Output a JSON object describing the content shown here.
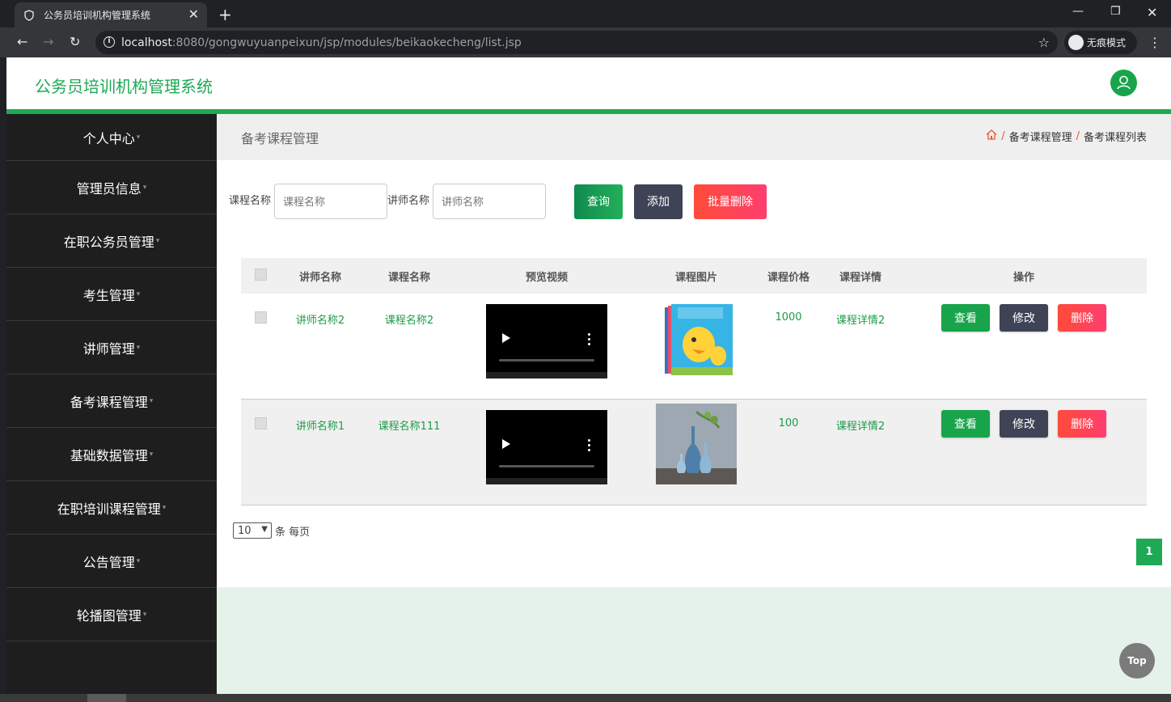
{
  "browser": {
    "tab_title": "公务员培训机构管理系统",
    "url_host": "localhost",
    "url_path": ":8080/gongwuyuanpeixun/jsp/modules/beikaokecheng/list.jsp",
    "incognito_label": "无痕模式"
  },
  "app": {
    "title": "公务员培训机构管理系统",
    "accent_color": "#1eaa54"
  },
  "sidebar": {
    "items": [
      {
        "label": "个人中心"
      },
      {
        "label": "管理员信息"
      },
      {
        "label": "在职公务员管理"
      },
      {
        "label": "考生管理"
      },
      {
        "label": "讲师管理"
      },
      {
        "label": "备考课程管理"
      },
      {
        "label": "基础数据管理"
      },
      {
        "label": "在职培训课程管理"
      },
      {
        "label": "公告管理"
      },
      {
        "label": "轮播图管理"
      }
    ]
  },
  "page": {
    "title": "备考课程管理",
    "breadcrumb": [
      "备考课程管理",
      "备考课程列表"
    ]
  },
  "search": {
    "course_label": "课程名称",
    "course_placeholder": "课程名称",
    "teacher_label": "讲师名称",
    "teacher_placeholder": "讲师名称",
    "query_button": "查询",
    "add_button": "添加",
    "batch_delete_button": "批量删除"
  },
  "table": {
    "headers": [
      "讲师名称",
      "课程名称",
      "预览视频",
      "课程图片",
      "课程价格",
      "课程详情",
      "操作"
    ],
    "rows": [
      {
        "teacher": "讲师名称2",
        "course": "课程名称2",
        "price": "1000",
        "detail": "课程详情2",
        "image": "book-cover"
      },
      {
        "teacher": "讲师名称1",
        "course": "课程名称111",
        "price": "100",
        "detail": "课程详情2",
        "image": "vases-photo"
      }
    ],
    "actions": {
      "view": "查看",
      "edit": "修改",
      "delete": "删除"
    }
  },
  "pager": {
    "page_size": "10",
    "per_page_text": "条 每页",
    "current_page": "1"
  },
  "top_button": "Top"
}
